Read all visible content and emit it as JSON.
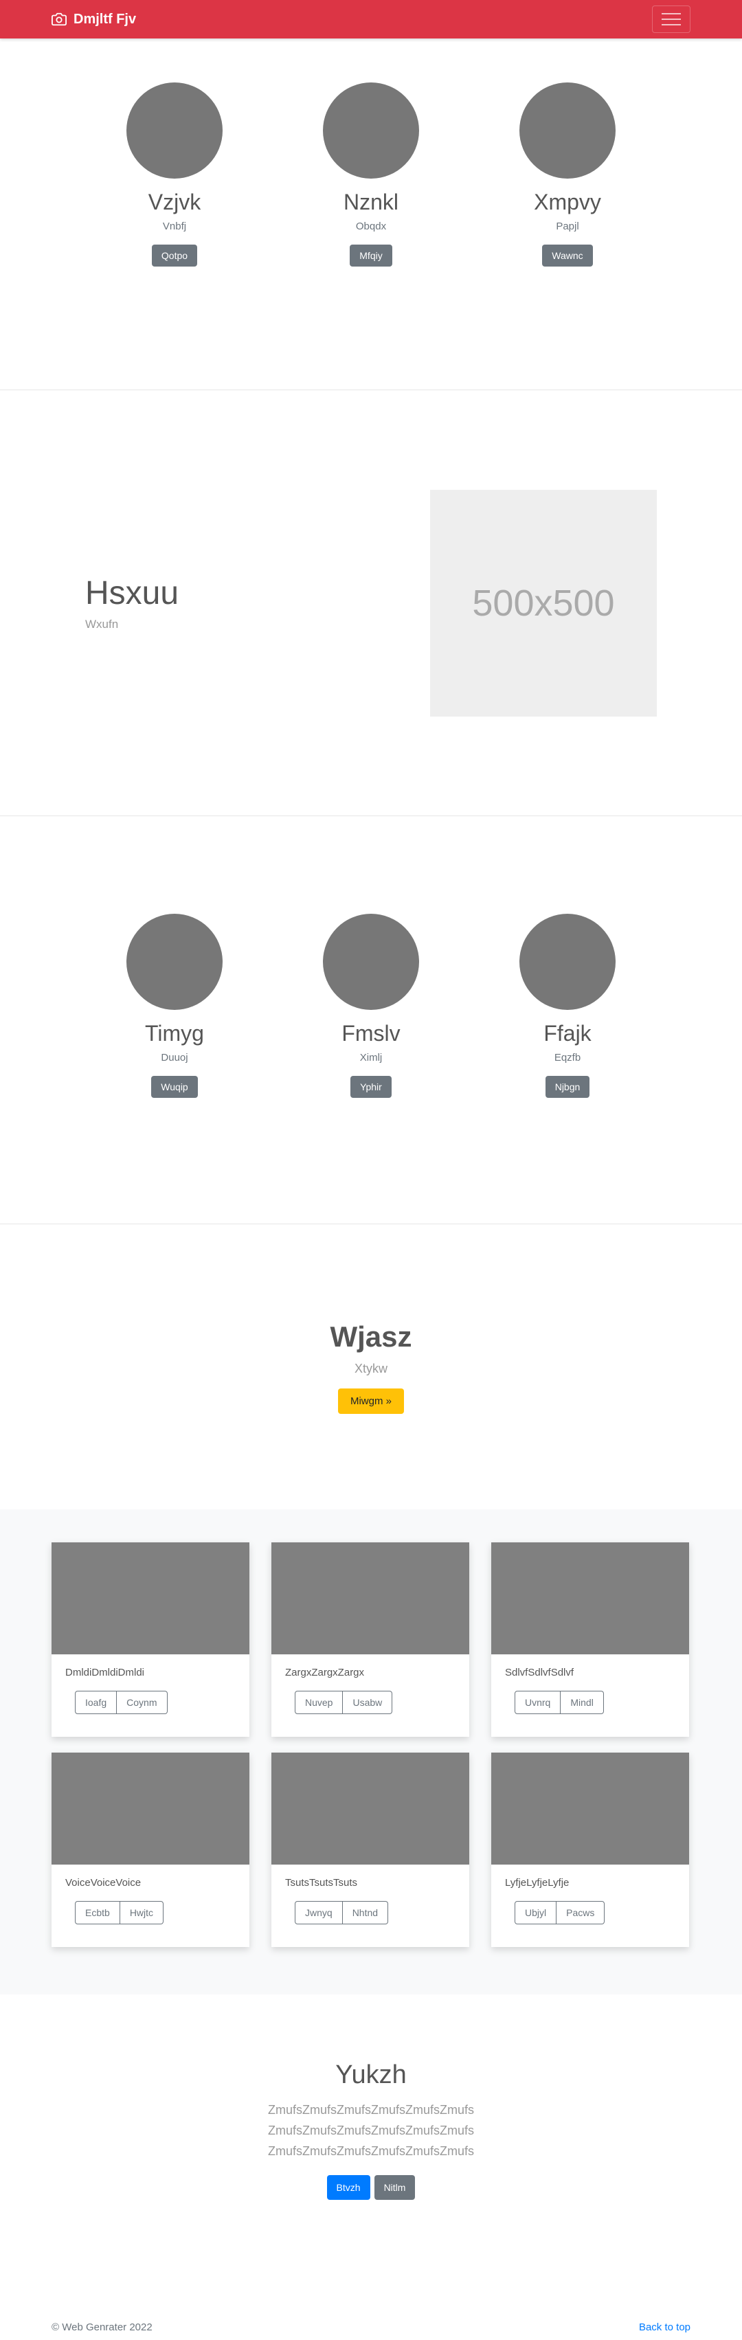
{
  "navbar": {
    "brand": "Dmjltf Fjv",
    "brand_icon": "camera-icon",
    "toggler_icon": "hamburger-icon",
    "color": "#dc3545"
  },
  "profiles_1": [
    {
      "name": "Vzjvk",
      "sub": "Vnbfj",
      "button": "Qotpo"
    },
    {
      "name": "Nznkl",
      "sub": "Obqdx",
      "button": "Mfqiy"
    },
    {
      "name": "Xmpvy",
      "sub": "Papjl",
      "button": "Wawnc"
    }
  ],
  "feature": {
    "title": "Hsxuu",
    "subtitle": "Wxufn",
    "placeholder": "500x500"
  },
  "profiles_2": [
    {
      "name": "Timyg",
      "sub": "Duuoj",
      "button": "Wuqip"
    },
    {
      "name": "Fmslv",
      "sub": "Ximlj",
      "button": "Yphir"
    },
    {
      "name": "Ffajk",
      "sub": "Eqzfb",
      "button": "Njbgn"
    }
  ],
  "jumbotron": {
    "title": "Wjasz",
    "subtitle": "Xtykw",
    "button": "Miwgm »"
  },
  "cards": [
    {
      "text": "DmldiDmldiDmldi",
      "btn1": "Ioafg",
      "btn2": "Coynm"
    },
    {
      "text": "ZargxZargxZargx",
      "btn1": "Nuvep",
      "btn2": "Usabw"
    },
    {
      "text": "SdlvfSdlvfSdlvf",
      "btn1": "Uvnrq",
      "btn2": "Mindl"
    },
    {
      "text": "VoiceVoiceVoice",
      "btn1": "Ecbtb",
      "btn2": "Hwjtc"
    },
    {
      "text": "TsutsTsutsTsuts",
      "btn1": "Jwnyq",
      "btn2": "Nhtnd"
    },
    {
      "text": "LyfjeLyfjeLyfje",
      "btn1": "Ubjyl",
      "btn2": "Pacws"
    }
  ],
  "about": {
    "title": "Yukzh",
    "lines": [
      "ZmufsZmufsZmufsZmufsZmufsZmufs",
      "ZmufsZmufsZmufsZmufsZmufsZmufs",
      "ZmufsZmufsZmufsZmufsZmufsZmufs"
    ],
    "btn_primary": "Btvzh",
    "btn_secondary": "Nitlm"
  },
  "footer": {
    "copyright": "© Web Genrater 2022",
    "back_to_top": "Back to top"
  }
}
